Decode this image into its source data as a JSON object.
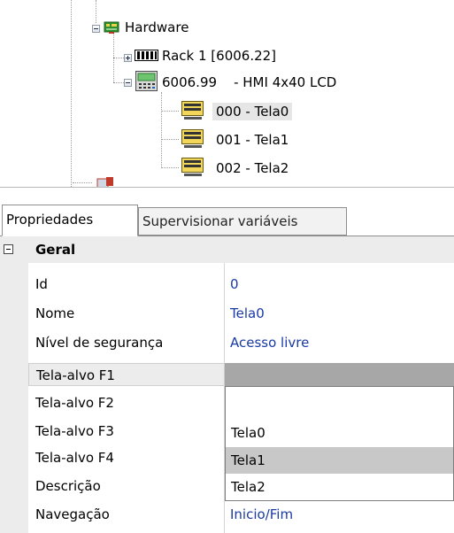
{
  "tree": {
    "nodes": [
      {
        "label": "Hardware",
        "icon": "hardware-icon"
      },
      {
        "label": "Rack 1 [6006.22]",
        "icon": "rack-icon"
      },
      {
        "label": "6006.99    - HMI 4x40 LCD",
        "icon": "hmi-icon"
      },
      {
        "label": "000 - Tela0",
        "icon": "screen-icon"
      },
      {
        "label": "001 - Tela1",
        "icon": "screen-icon"
      },
      {
        "label": "002 - Tela2",
        "icon": "screen-icon"
      }
    ]
  },
  "tabs": [
    {
      "label": "Propriedades",
      "active": true
    },
    {
      "label": "Supervisionar variáveis",
      "active": false
    }
  ],
  "grid": {
    "category": "Geral",
    "properties": [
      {
        "name": "Id",
        "value": "0"
      },
      {
        "name": "Nome",
        "value": "Tela0"
      },
      {
        "name": "Nível de segurança",
        "value": "Acesso livre"
      },
      {
        "name": "Tela-alvo F1",
        "value": ""
      },
      {
        "name": "Tela-alvo F2",
        "value": ""
      },
      {
        "name": "Tela-alvo F3",
        "value": ""
      },
      {
        "name": "Tela-alvo F4",
        "value": ""
      },
      {
        "name": "Descrição",
        "value": ""
      },
      {
        "name": "Navegação",
        "value": "Inicio/Fim"
      }
    ]
  },
  "dropdown": {
    "options": [
      "",
      "Tela0",
      "Tela1",
      "Tela2"
    ],
    "highlighted": "Tela1"
  },
  "colors": {
    "value_text": "#1a3aa5",
    "selected_value_bg": "#a7a7a7",
    "highlight_bg": "#c8c8c8",
    "gutter_bg": "#ececec"
  }
}
